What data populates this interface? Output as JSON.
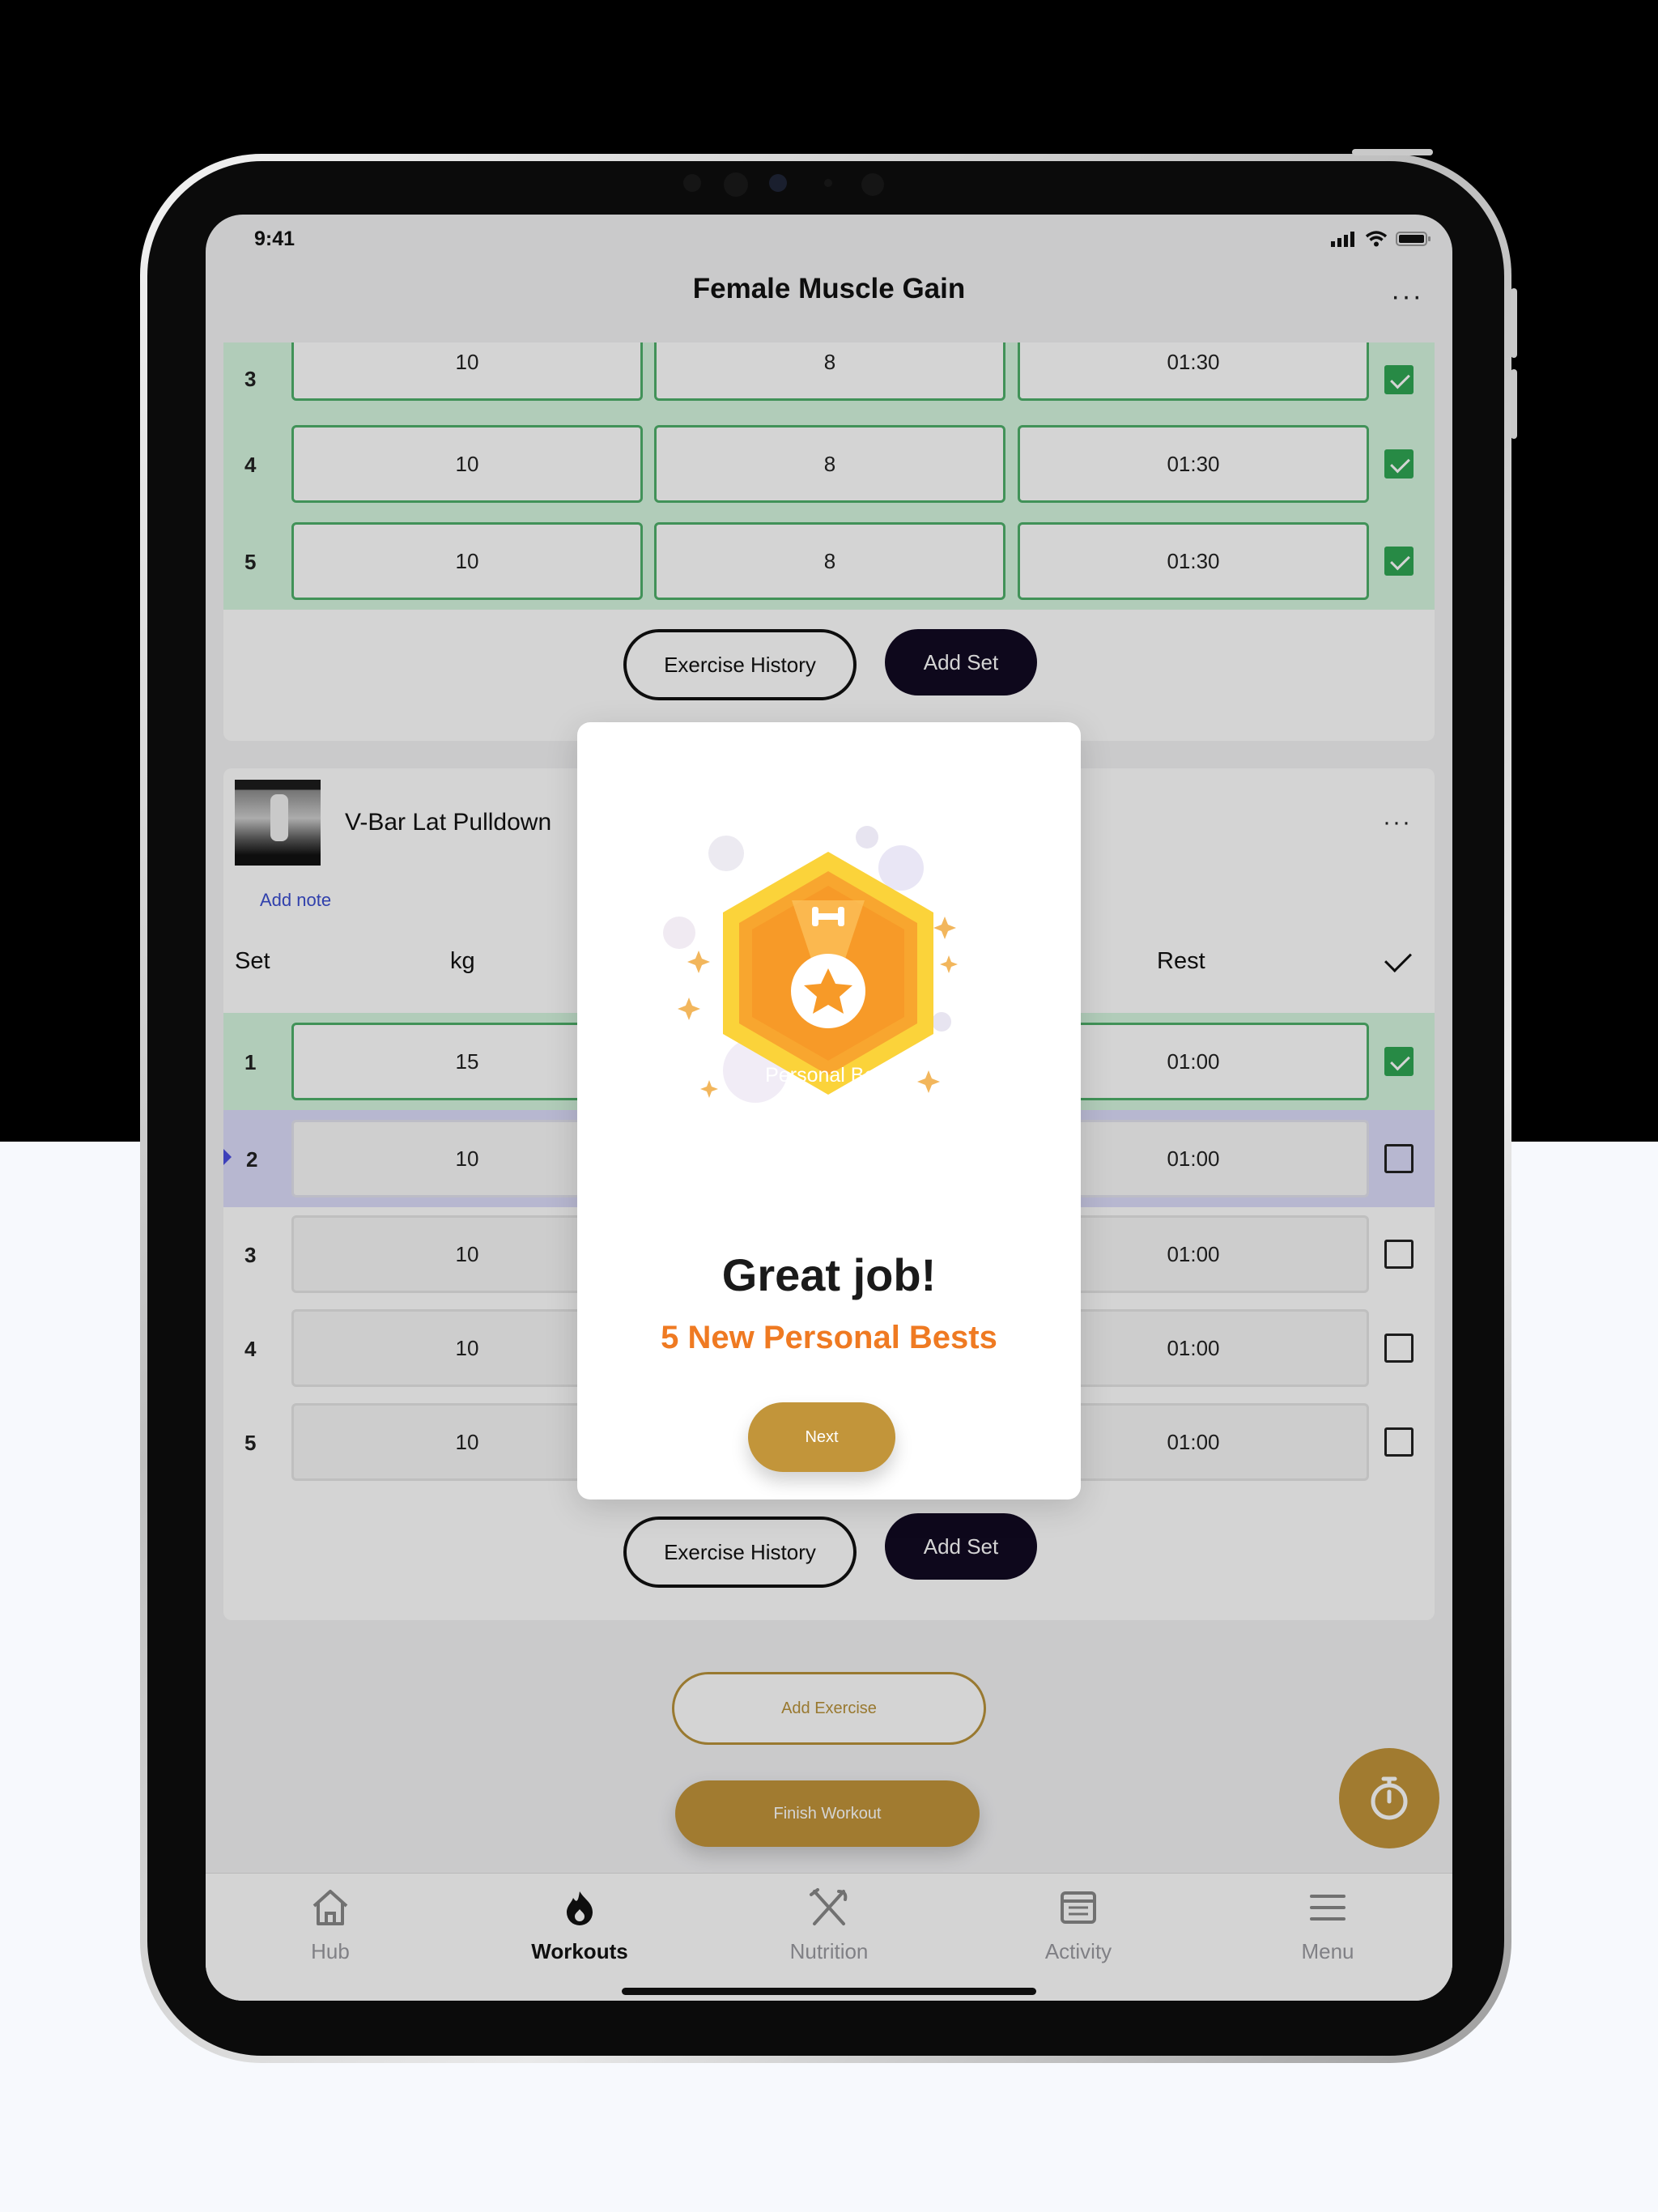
{
  "status_bar": {
    "time": "9:41"
  },
  "nav": {
    "title": "Female Muscle Gain",
    "more": "···"
  },
  "card1": {
    "rows": [
      {
        "set": "3",
        "kg": "10",
        "reps": "8",
        "rest": "01:30"
      },
      {
        "set": "4",
        "kg": "10",
        "reps": "8",
        "rest": "01:30"
      },
      {
        "set": "5",
        "kg": "10",
        "reps": "8",
        "rest": "01:30"
      }
    ],
    "history_label": "Exercise History",
    "add_set_label": "Add Set"
  },
  "card2": {
    "exercise_name": "V-Bar Lat Pulldown",
    "more": "···",
    "add_note": "Add note",
    "headers": {
      "set": "Set",
      "kg": "kg",
      "rest": "Rest"
    },
    "rows": [
      {
        "set": "1",
        "kg": "15",
        "rest": "01:00",
        "done": true
      },
      {
        "set": "2",
        "kg": "10",
        "rest": "01:00",
        "done": false,
        "active": true
      },
      {
        "set": "3",
        "kg": "10",
        "rest": "01:00",
        "done": false
      },
      {
        "set": "4",
        "kg": "10",
        "rest": "01:00",
        "done": false
      },
      {
        "set": "5",
        "kg": "10",
        "rest": "01:00",
        "done": false
      }
    ],
    "history_label": "Exercise History",
    "add_set_label": "Add Set"
  },
  "actions": {
    "add_exercise": "Add Exercise",
    "finish_workout": "Finish Workout"
  },
  "tabs": [
    {
      "label": "Hub",
      "icon": "home-icon"
    },
    {
      "label": "Workouts",
      "icon": "flame-icon",
      "active": true
    },
    {
      "label": "Nutrition",
      "icon": "utensils-icon"
    },
    {
      "label": "Activity",
      "icon": "activity-icon"
    },
    {
      "label": "Menu",
      "icon": "menu-icon"
    }
  ],
  "modal": {
    "badge_text": "Personal Best",
    "title": "Great job!",
    "subtitle": "5 New Personal Bests",
    "next_label": "Next"
  },
  "colors": {
    "gold": "#c2953a",
    "orange": "#ef7a22",
    "done_green": "#d5f6df",
    "active_purple": "#dcdcfb",
    "dark_button": "#120a22"
  }
}
